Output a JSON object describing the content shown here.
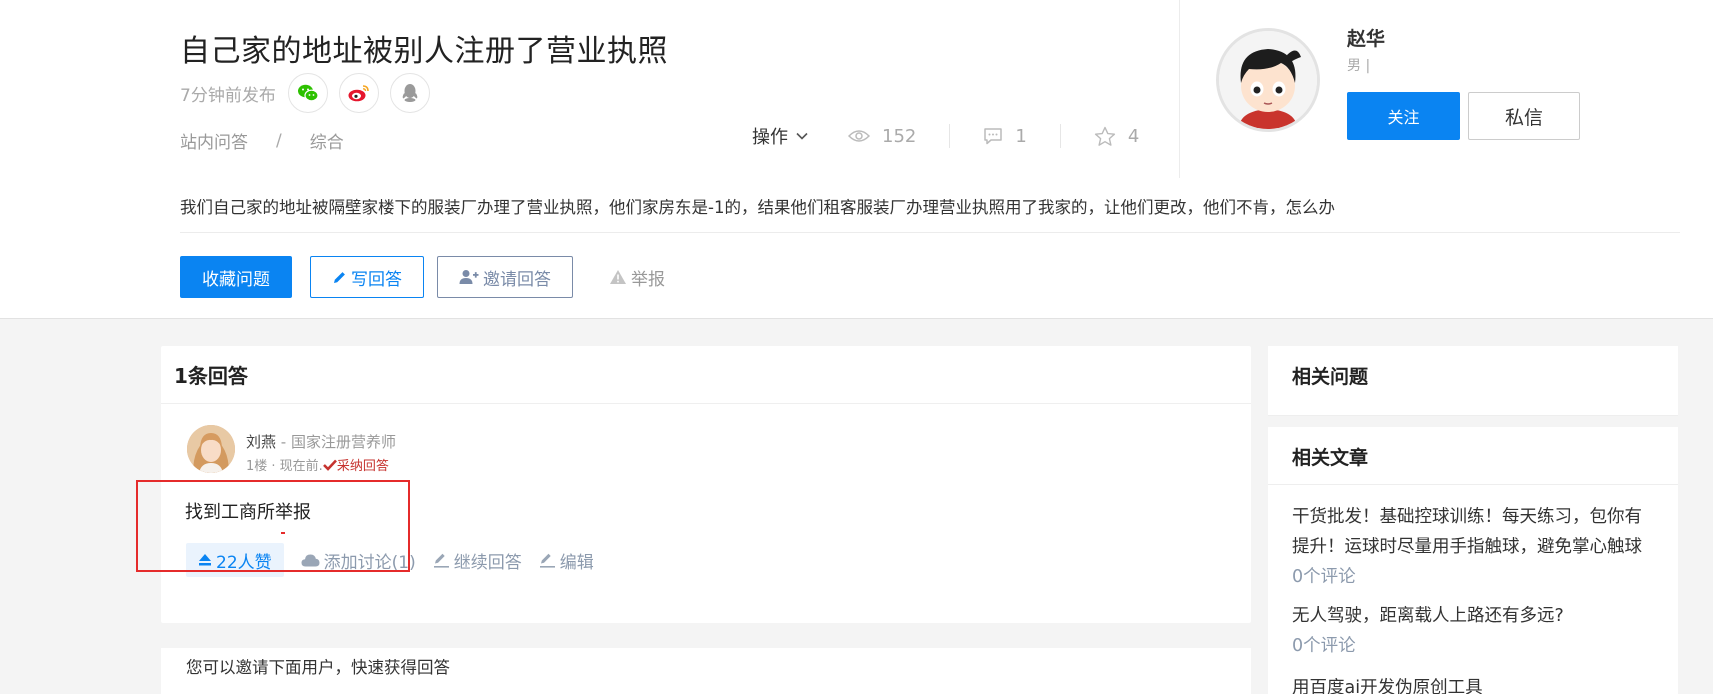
{
  "question": {
    "title": "自己家的地址被别人注册了营业执照",
    "time": "7分钟前发布",
    "share_icons": [
      "wechat-icon",
      "weibo-icon",
      "qq-icon"
    ],
    "breadcrumb": [
      "站内问答",
      "综合"
    ],
    "breadcrumb_sep": "/",
    "ops_label": "操作",
    "views": "152",
    "comments": "1",
    "favorites": "4",
    "description": "我们自己家的地址被隔壁家楼下的服装厂办理了营业执照，他们家房东是-1的，结果他们租客服装厂办理营业执照用了我家的，让他们更改，他们不肯，怎么办",
    "buttons": {
      "favorite": "收藏问题",
      "write": "写回答",
      "invite": "邀请回答",
      "report": "举报"
    }
  },
  "author": {
    "name": "赵华",
    "gender": "男 |",
    "follow": "关注",
    "message": "私信"
  },
  "answers": {
    "title": "1条回答",
    "items": [
      {
        "name": "刘燕",
        "title": " - 国家注册营养师",
        "meta": "1楼 · 现在前.",
        "adopted": "采纳回答",
        "content": "找到工商所举报",
        "votes": "22人赞",
        "discuss": "添加讨论(1)",
        "continue": "继续回答",
        "edit": "编辑"
      }
    ]
  },
  "invite_text": "您可以邀请下面用户，快速获得回答",
  "sidebar": {
    "related_questions_title": "相关问题",
    "related_articles_title": "相关文章",
    "articles": [
      {
        "title": "干货批发！基础控球训练！每天练习，包你有提升！运球时尽量用手指触球，避免掌心触球",
        "comments": "0个评论"
      },
      {
        "title": "无人驾驶，距离载人上路还有多远?",
        "comments": "0个评论"
      },
      {
        "title": "用百度ai开发伪原创工具",
        "comments": ""
      }
    ]
  },
  "colors": {
    "primary": "#0a84f2",
    "adopted": "#c6332f",
    "highlight_box": "#e52b2b",
    "muted": "#8c9aad",
    "wechat": "#2dc100",
    "weibo": "#e6162d",
    "qq": "#9a9a9a"
  }
}
